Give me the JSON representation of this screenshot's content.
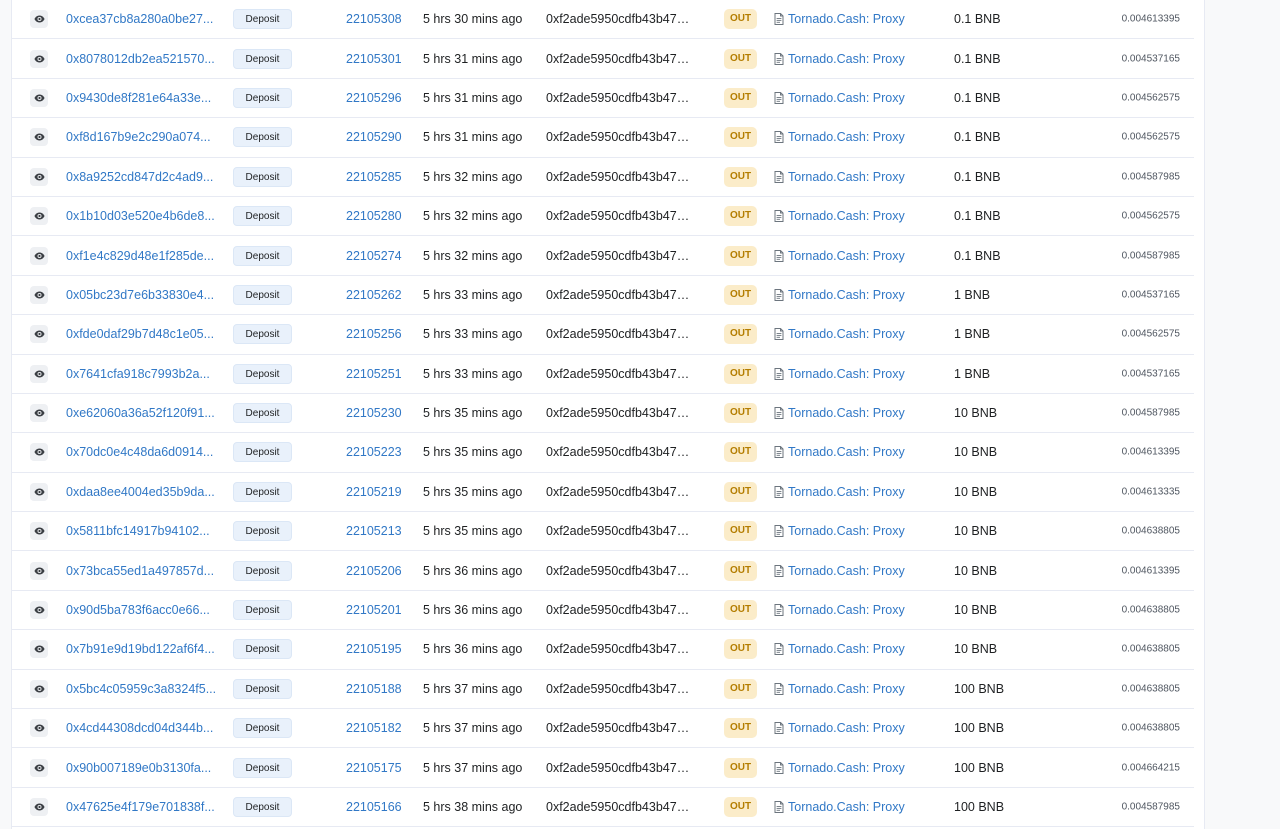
{
  "colors": {
    "link": "#3178c6",
    "out_badge_bg": "#fbecc9",
    "out_badge_text": "#b47d00",
    "method_badge_bg": "#e9f1fb",
    "row_border": "#e7eaf3"
  },
  "icons": {
    "view": "eye-icon",
    "contract": "contract-document-icon"
  },
  "transactions": [
    {
      "hash": "0xcea37cb8a280a0be27...",
      "method": "Deposit",
      "block": "22105308",
      "age": "5 hrs 30 mins ago",
      "from": "0xf2ade5950cdfb43b47f...",
      "direction": "OUT",
      "to": "Tornado.Cash: Proxy",
      "value": "0.1 BNB",
      "fee": "0.004613395"
    },
    {
      "hash": "0x8078012db2ea521570...",
      "method": "Deposit",
      "block": "22105301",
      "age": "5 hrs 31 mins ago",
      "from": "0xf2ade5950cdfb43b47f...",
      "direction": "OUT",
      "to": "Tornado.Cash: Proxy",
      "value": "0.1 BNB",
      "fee": "0.004537165"
    },
    {
      "hash": "0x9430de8f281e64a33e...",
      "method": "Deposit",
      "block": "22105296",
      "age": "5 hrs 31 mins ago",
      "from": "0xf2ade5950cdfb43b47f...",
      "direction": "OUT",
      "to": "Tornado.Cash: Proxy",
      "value": "0.1 BNB",
      "fee": "0.004562575"
    },
    {
      "hash": "0xf8d167b9e2c290a074...",
      "method": "Deposit",
      "block": "22105290",
      "age": "5 hrs 31 mins ago",
      "from": "0xf2ade5950cdfb43b47f...",
      "direction": "OUT",
      "to": "Tornado.Cash: Proxy",
      "value": "0.1 BNB",
      "fee": "0.004562575"
    },
    {
      "hash": "0x8a9252cd847d2c4ad9...",
      "method": "Deposit",
      "block": "22105285",
      "age": "5 hrs 32 mins ago",
      "from": "0xf2ade5950cdfb43b47f...",
      "direction": "OUT",
      "to": "Tornado.Cash: Proxy",
      "value": "0.1 BNB",
      "fee": "0.004587985"
    },
    {
      "hash": "0x1b10d03e520e4b6de8...",
      "method": "Deposit",
      "block": "22105280",
      "age": "5 hrs 32 mins ago",
      "from": "0xf2ade5950cdfb43b47f...",
      "direction": "OUT",
      "to": "Tornado.Cash: Proxy",
      "value": "0.1 BNB",
      "fee": "0.004562575"
    },
    {
      "hash": "0xf1e4c829d48e1f285de...",
      "method": "Deposit",
      "block": "22105274",
      "age": "5 hrs 32 mins ago",
      "from": "0xf2ade5950cdfb43b47f...",
      "direction": "OUT",
      "to": "Tornado.Cash: Proxy",
      "value": "0.1 BNB",
      "fee": "0.004587985"
    },
    {
      "hash": "0x05bc23d7e6b33830e4...",
      "method": "Deposit",
      "block": "22105262",
      "age": "5 hrs 33 mins ago",
      "from": "0xf2ade5950cdfb43b47f...",
      "direction": "OUT",
      "to": "Tornado.Cash: Proxy",
      "value": "1 BNB",
      "fee": "0.004537165"
    },
    {
      "hash": "0xfde0daf29b7d48c1e05...",
      "method": "Deposit",
      "block": "22105256",
      "age": "5 hrs 33 mins ago",
      "from": "0xf2ade5950cdfb43b47f...",
      "direction": "OUT",
      "to": "Tornado.Cash: Proxy",
      "value": "1 BNB",
      "fee": "0.004562575"
    },
    {
      "hash": "0x7641cfa918c7993b2a...",
      "method": "Deposit",
      "block": "22105251",
      "age": "5 hrs 33 mins ago",
      "from": "0xf2ade5950cdfb43b47f...",
      "direction": "OUT",
      "to": "Tornado.Cash: Proxy",
      "value": "1 BNB",
      "fee": "0.004537165"
    },
    {
      "hash": "0xe62060a36a52f120f91...",
      "method": "Deposit",
      "block": "22105230",
      "age": "5 hrs 35 mins ago",
      "from": "0xf2ade5950cdfb43b47f...",
      "direction": "OUT",
      "to": "Tornado.Cash: Proxy",
      "value": "10 BNB",
      "fee": "0.004587985"
    },
    {
      "hash": "0x70dc0e4c48da6d0914...",
      "method": "Deposit",
      "block": "22105223",
      "age": "5 hrs 35 mins ago",
      "from": "0xf2ade5950cdfb43b47f...",
      "direction": "OUT",
      "to": "Tornado.Cash: Proxy",
      "value": "10 BNB",
      "fee": "0.004613395"
    },
    {
      "hash": "0xdaa8ee4004ed35b9da...",
      "method": "Deposit",
      "block": "22105219",
      "age": "5 hrs 35 mins ago",
      "from": "0xf2ade5950cdfb43b47f...",
      "direction": "OUT",
      "to": "Tornado.Cash: Proxy",
      "value": "10 BNB",
      "fee": "0.004613335"
    },
    {
      "hash": "0x5811bfc14917b94102...",
      "method": "Deposit",
      "block": "22105213",
      "age": "5 hrs 35 mins ago",
      "from": "0xf2ade5950cdfb43b47f...",
      "direction": "OUT",
      "to": "Tornado.Cash: Proxy",
      "value": "10 BNB",
      "fee": "0.004638805"
    },
    {
      "hash": "0x73bca55ed1a497857d...",
      "method": "Deposit",
      "block": "22105206",
      "age": "5 hrs 36 mins ago",
      "from": "0xf2ade5950cdfb43b47f...",
      "direction": "OUT",
      "to": "Tornado.Cash: Proxy",
      "value": "10 BNB",
      "fee": "0.004613395"
    },
    {
      "hash": "0x90d5ba783f6acc0e66...",
      "method": "Deposit",
      "block": "22105201",
      "age": "5 hrs 36 mins ago",
      "from": "0xf2ade5950cdfb43b47f...",
      "direction": "OUT",
      "to": "Tornado.Cash: Proxy",
      "value": "10 BNB",
      "fee": "0.004638805"
    },
    {
      "hash": "0x7b91e9d19bd122af6f4...",
      "method": "Deposit",
      "block": "22105195",
      "age": "5 hrs 36 mins ago",
      "from": "0xf2ade5950cdfb43b47f...",
      "direction": "OUT",
      "to": "Tornado.Cash: Proxy",
      "value": "10 BNB",
      "fee": "0.004638805"
    },
    {
      "hash": "0x5bc4c05959c3a8324f5...",
      "method": "Deposit",
      "block": "22105188",
      "age": "5 hrs 37 mins ago",
      "from": "0xf2ade5950cdfb43b47f...",
      "direction": "OUT",
      "to": "Tornado.Cash: Proxy",
      "value": "100 BNB",
      "fee": "0.004638805"
    },
    {
      "hash": "0x4cd44308dcd04d344b...",
      "method": "Deposit",
      "block": "22105182",
      "age": "5 hrs 37 mins ago",
      "from": "0xf2ade5950cdfb43b47f...",
      "direction": "OUT",
      "to": "Tornado.Cash: Proxy",
      "value": "100 BNB",
      "fee": "0.004638805"
    },
    {
      "hash": "0x90b007189e0b3130fa...",
      "method": "Deposit",
      "block": "22105175",
      "age": "5 hrs 37 mins ago",
      "from": "0xf2ade5950cdfb43b47f...",
      "direction": "OUT",
      "to": "Tornado.Cash: Proxy",
      "value": "100 BNB",
      "fee": "0.004664215"
    },
    {
      "hash": "0x47625e4f179e701838f...",
      "method": "Deposit",
      "block": "22105166",
      "age": "5 hrs 38 mins ago",
      "from": "0xf2ade5950cdfb43b47f...",
      "direction": "OUT",
      "to": "Tornado.Cash: Proxy",
      "value": "100 BNB",
      "fee": "0.004587985"
    }
  ]
}
